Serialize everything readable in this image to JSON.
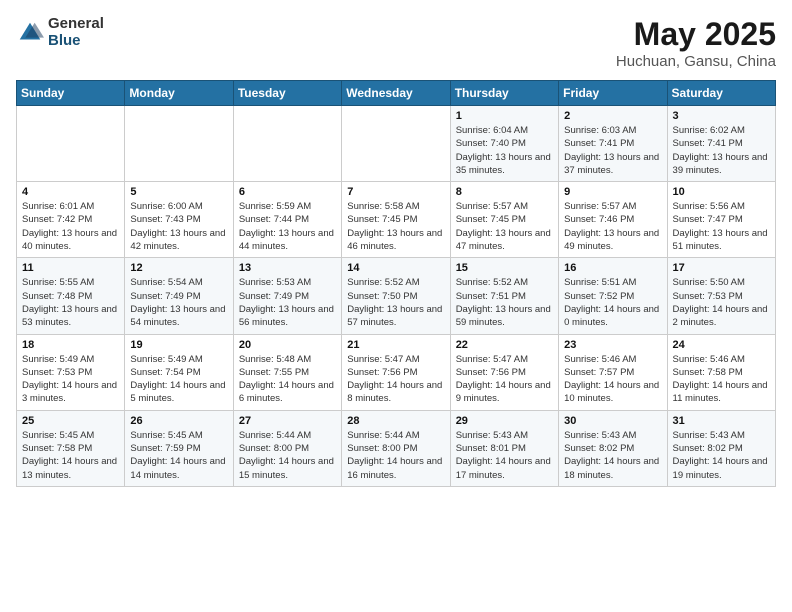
{
  "header": {
    "logo_general": "General",
    "logo_blue": "Blue",
    "title": "May 2025",
    "subtitle": "Huchuan, Gansu, China"
  },
  "days_of_week": [
    "Sunday",
    "Monday",
    "Tuesday",
    "Wednesday",
    "Thursday",
    "Friday",
    "Saturday"
  ],
  "weeks": [
    [
      {
        "num": "",
        "detail": ""
      },
      {
        "num": "",
        "detail": ""
      },
      {
        "num": "",
        "detail": ""
      },
      {
        "num": "",
        "detail": ""
      },
      {
        "num": "1",
        "detail": "Sunrise: 6:04 AM\nSunset: 7:40 PM\nDaylight: 13 hours\nand 35 minutes."
      },
      {
        "num": "2",
        "detail": "Sunrise: 6:03 AM\nSunset: 7:41 PM\nDaylight: 13 hours\nand 37 minutes."
      },
      {
        "num": "3",
        "detail": "Sunrise: 6:02 AM\nSunset: 7:41 PM\nDaylight: 13 hours\nand 39 minutes."
      }
    ],
    [
      {
        "num": "4",
        "detail": "Sunrise: 6:01 AM\nSunset: 7:42 PM\nDaylight: 13 hours\nand 40 minutes."
      },
      {
        "num": "5",
        "detail": "Sunrise: 6:00 AM\nSunset: 7:43 PM\nDaylight: 13 hours\nand 42 minutes."
      },
      {
        "num": "6",
        "detail": "Sunrise: 5:59 AM\nSunset: 7:44 PM\nDaylight: 13 hours\nand 44 minutes."
      },
      {
        "num": "7",
        "detail": "Sunrise: 5:58 AM\nSunset: 7:45 PM\nDaylight: 13 hours\nand 46 minutes."
      },
      {
        "num": "8",
        "detail": "Sunrise: 5:57 AM\nSunset: 7:45 PM\nDaylight: 13 hours\nand 47 minutes."
      },
      {
        "num": "9",
        "detail": "Sunrise: 5:57 AM\nSunset: 7:46 PM\nDaylight: 13 hours\nand 49 minutes."
      },
      {
        "num": "10",
        "detail": "Sunrise: 5:56 AM\nSunset: 7:47 PM\nDaylight: 13 hours\nand 51 minutes."
      }
    ],
    [
      {
        "num": "11",
        "detail": "Sunrise: 5:55 AM\nSunset: 7:48 PM\nDaylight: 13 hours\nand 53 minutes."
      },
      {
        "num": "12",
        "detail": "Sunrise: 5:54 AM\nSunset: 7:49 PM\nDaylight: 13 hours\nand 54 minutes."
      },
      {
        "num": "13",
        "detail": "Sunrise: 5:53 AM\nSunset: 7:49 PM\nDaylight: 13 hours\nand 56 minutes."
      },
      {
        "num": "14",
        "detail": "Sunrise: 5:52 AM\nSunset: 7:50 PM\nDaylight: 13 hours\nand 57 minutes."
      },
      {
        "num": "15",
        "detail": "Sunrise: 5:52 AM\nSunset: 7:51 PM\nDaylight: 13 hours\nand 59 minutes."
      },
      {
        "num": "16",
        "detail": "Sunrise: 5:51 AM\nSunset: 7:52 PM\nDaylight: 14 hours\nand 0 minutes."
      },
      {
        "num": "17",
        "detail": "Sunrise: 5:50 AM\nSunset: 7:53 PM\nDaylight: 14 hours\nand 2 minutes."
      }
    ],
    [
      {
        "num": "18",
        "detail": "Sunrise: 5:49 AM\nSunset: 7:53 PM\nDaylight: 14 hours\nand 3 minutes."
      },
      {
        "num": "19",
        "detail": "Sunrise: 5:49 AM\nSunset: 7:54 PM\nDaylight: 14 hours\nand 5 minutes."
      },
      {
        "num": "20",
        "detail": "Sunrise: 5:48 AM\nSunset: 7:55 PM\nDaylight: 14 hours\nand 6 minutes."
      },
      {
        "num": "21",
        "detail": "Sunrise: 5:47 AM\nSunset: 7:56 PM\nDaylight: 14 hours\nand 8 minutes."
      },
      {
        "num": "22",
        "detail": "Sunrise: 5:47 AM\nSunset: 7:56 PM\nDaylight: 14 hours\nand 9 minutes."
      },
      {
        "num": "23",
        "detail": "Sunrise: 5:46 AM\nSunset: 7:57 PM\nDaylight: 14 hours\nand 10 minutes."
      },
      {
        "num": "24",
        "detail": "Sunrise: 5:46 AM\nSunset: 7:58 PM\nDaylight: 14 hours\nand 11 minutes."
      }
    ],
    [
      {
        "num": "25",
        "detail": "Sunrise: 5:45 AM\nSunset: 7:58 PM\nDaylight: 14 hours\nand 13 minutes."
      },
      {
        "num": "26",
        "detail": "Sunrise: 5:45 AM\nSunset: 7:59 PM\nDaylight: 14 hours\nand 14 minutes."
      },
      {
        "num": "27",
        "detail": "Sunrise: 5:44 AM\nSunset: 8:00 PM\nDaylight: 14 hours\nand 15 minutes."
      },
      {
        "num": "28",
        "detail": "Sunrise: 5:44 AM\nSunset: 8:00 PM\nDaylight: 14 hours\nand 16 minutes."
      },
      {
        "num": "29",
        "detail": "Sunrise: 5:43 AM\nSunset: 8:01 PM\nDaylight: 14 hours\nand 17 minutes."
      },
      {
        "num": "30",
        "detail": "Sunrise: 5:43 AM\nSunset: 8:02 PM\nDaylight: 14 hours\nand 18 minutes."
      },
      {
        "num": "31",
        "detail": "Sunrise: 5:43 AM\nSunset: 8:02 PM\nDaylight: 14 hours\nand 19 minutes."
      }
    ]
  ]
}
